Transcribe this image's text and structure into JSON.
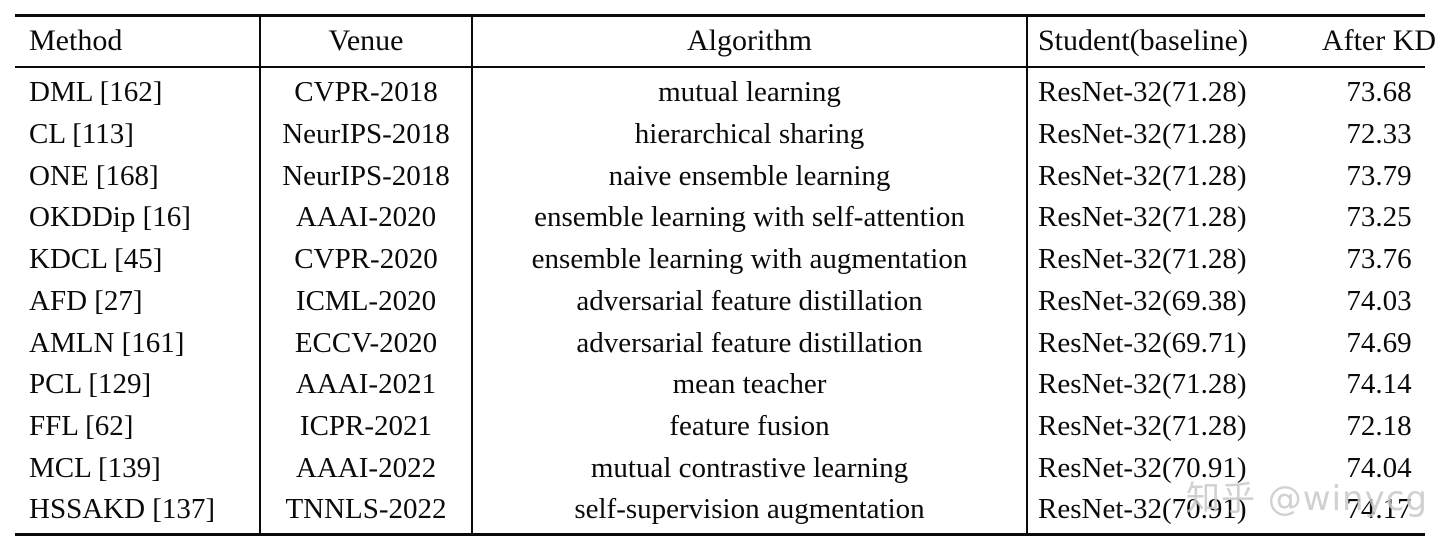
{
  "table": {
    "columns": [
      {
        "key": "method",
        "header": "Method"
      },
      {
        "key": "venue",
        "header": "Venue"
      },
      {
        "key": "algorithm",
        "header": "Algorithm"
      },
      {
        "key": "student",
        "header": "Student(baseline)"
      },
      {
        "key": "after_kd",
        "header": "After KD"
      }
    ],
    "rows": [
      {
        "method": "DML [162]",
        "venue": "CVPR-2018",
        "algorithm": "mutual learning",
        "student": "ResNet-32(71.28)",
        "after_kd": "73.68"
      },
      {
        "method": "CL [113]",
        "venue": "NeurIPS-2018",
        "algorithm": "hierarchical sharing",
        "student": "ResNet-32(71.28)",
        "after_kd": "72.33"
      },
      {
        "method": "ONE [168]",
        "venue": "NeurIPS-2018",
        "algorithm": "naive ensemble learning",
        "student": "ResNet-32(71.28)",
        "after_kd": "73.79"
      },
      {
        "method": "OKDDip [16]",
        "venue": "AAAI-2020",
        "algorithm": "ensemble learning with self-attention",
        "student": "ResNet-32(71.28)",
        "after_kd": "73.25"
      },
      {
        "method": "KDCL [45]",
        "venue": "CVPR-2020",
        "algorithm": "ensemble learning with augmentation",
        "student": "ResNet-32(71.28)",
        "after_kd": "73.76"
      },
      {
        "method": "AFD [27]",
        "venue": "ICML-2020",
        "algorithm": "adversarial feature distillation",
        "student": "ResNet-32(69.38)",
        "after_kd": "74.03"
      },
      {
        "method": "AMLN [161]",
        "venue": "ECCV-2020",
        "algorithm": "adversarial feature distillation",
        "student": "ResNet-32(69.71)",
        "after_kd": "74.69"
      },
      {
        "method": "PCL [129]",
        "venue": "AAAI-2021",
        "algorithm": "mean teacher",
        "student": "ResNet-32(71.28)",
        "after_kd": "74.14"
      },
      {
        "method": "FFL [62]",
        "venue": "ICPR-2021",
        "algorithm": "feature fusion",
        "student": "ResNet-32(71.28)",
        "after_kd": "72.18"
      },
      {
        "method": "MCL [139]",
        "venue": "AAAI-2022",
        "algorithm": "mutual contrastive learning",
        "student": "ResNet-32(70.91)",
        "after_kd": "74.04"
      },
      {
        "method": "HSSAKD [137]",
        "venue": "TNNLS-2022",
        "algorithm": "self-supervision augmentation",
        "student": "ResNet-32(70.91)",
        "after_kd": "74.17"
      }
    ]
  },
  "watermark": {
    "text": "知乎 @winycg",
    "color": "#c9c9c9"
  }
}
